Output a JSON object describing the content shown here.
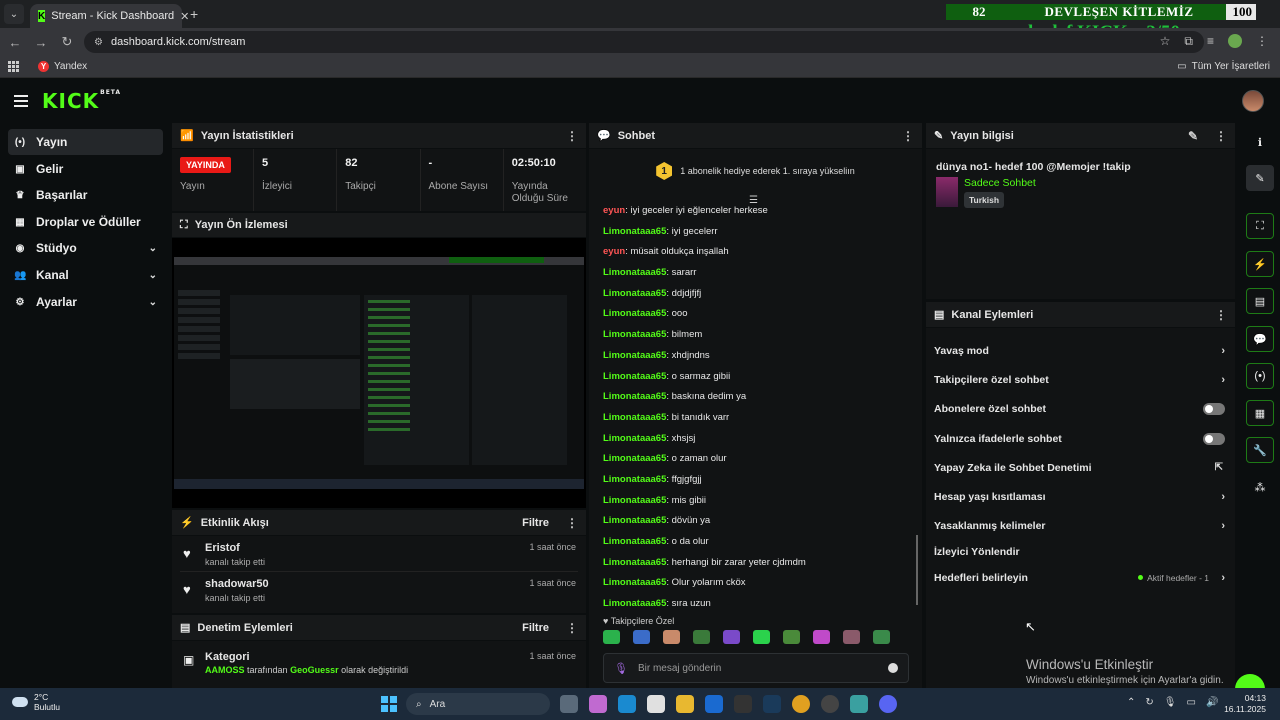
{
  "browser": {
    "tab_title": "Stream - Kick Dashboard",
    "url": "dashboard.kick.com/stream",
    "bookmark_yandex": "Yandex",
    "bookmarks_all": "Tüm Yer İşaretleri"
  },
  "overlay": {
    "count_left": "82",
    "title": "DEVLEŞEN KİTLEMİZ",
    "count_right": "100",
    "goal_text": "hedef KICKs: 2/50"
  },
  "app": {
    "logo": "KICK",
    "beta": "BETA"
  },
  "sidebar": {
    "items": [
      {
        "label": "Yayın"
      },
      {
        "label": "Gelir"
      },
      {
        "label": "Başarılar"
      },
      {
        "label": "Droplar ve Ödüller"
      },
      {
        "label": "Stüdyo"
      },
      {
        "label": "Kanal"
      },
      {
        "label": "Ayarlar"
      }
    ]
  },
  "stats": {
    "title": "Yayın İstatistikleri",
    "live_badge": "YAYINDA",
    "live_label": "Yayın",
    "viewers_value": "5",
    "viewers_label": "İzleyici",
    "followers_value": "82",
    "followers_label": "Takipçi",
    "subs_value": "-",
    "subs_label": "Abone Sayısı",
    "uptime_value": "02:50:10",
    "uptime_label": "Yayında Olduğu Süre"
  },
  "preview": {
    "title": "Yayın Ön İzlemesi"
  },
  "activity": {
    "title": "Etkinlik Akışı",
    "filter": "Filtre",
    "items": [
      {
        "name": "Eristof",
        "sub": "kanalı takip etti",
        "time": "1 saat önce"
      },
      {
        "name": "shadowar50",
        "sub": "kanalı takip etti",
        "time": "1 saat önce"
      }
    ]
  },
  "moderation": {
    "title": "Denetim Eylemleri",
    "filter": "Filtre",
    "item_title": "Kategori",
    "item_user": "AAMOSS",
    "item_mid": " tarafından ",
    "item_game": "GeoGuessr",
    "item_end": " olarak değiştirildi",
    "time": "1 saat önce"
  },
  "chat": {
    "title": "Sohbet",
    "banner": "1 abonelik hediye ederek 1. sıraya yükseliın",
    "medal": "1",
    "messages": [
      {
        "user": "eyun",
        "text": ": iyi geceler iyi eğlenceler herkese"
      },
      {
        "user": "Limonataaa65",
        "text": ": iyi gecelerr"
      },
      {
        "user": "eyun",
        "text": ": müsait oldukça inşallah"
      },
      {
        "user": "Limonataaa65",
        "text": ": sararr"
      },
      {
        "user": "Limonataaa65",
        "text": ": ddjdjfjfj"
      },
      {
        "user": "Limonataaa65",
        "text": ": ooo"
      },
      {
        "user": "Limonataaa65",
        "text": ": bilmem"
      },
      {
        "user": "Limonataaa65",
        "text": ": xhdjndns"
      },
      {
        "user": "Limonataaa65",
        "text": ": o sarmaz gibii"
      },
      {
        "user": "Limonataaa65",
        "text": ": baskına dedim ya"
      },
      {
        "user": "Limonataaa65",
        "text": ": bi tanıdık varr"
      },
      {
        "user": "Limonataaa65",
        "text": ": xhsjsj"
      },
      {
        "user": "Limonataaa65",
        "text": ": o zaman olur"
      },
      {
        "user": "Limonataaa65",
        "text": ": ffgjgfgjj"
      },
      {
        "user": "Limonataaa65",
        "text": ": mis gibii"
      },
      {
        "user": "Limonataaa65",
        "text": ": dövün ya"
      },
      {
        "user": "Limonataaa65",
        "text": ": o da olur"
      },
      {
        "user": "Limonataaa65",
        "text": ": herhangi bir zarar yeter cjdmdm"
      },
      {
        "user": "Limonataaa65",
        "text": ": Olur yolarım cköx"
      },
      {
        "user": "Limonataaa65",
        "text": ": sıra uzun"
      }
    ],
    "emotes_label": "Takipçilere Özel",
    "input_placeholder": "Bir mesaj gönderin"
  },
  "stream_info": {
    "title": "Yayın bilgisi",
    "stream_title": "dünya no1- hedef 100 @Memojer !takip",
    "category": "Sadece Sohbet",
    "tag": "Turkish"
  },
  "channel_actions": {
    "title": "Kanal Eylemleri",
    "items": [
      {
        "label": "Yavaş mod"
      },
      {
        "label": "Takipçilere özel sohbet"
      },
      {
        "label": "Abonelere özel sohbet"
      },
      {
        "label": "Yalnızca ifadelerle sohbet"
      },
      {
        "label": "Yapay Zeka ile Sohbet Denetimi"
      },
      {
        "label": "Hesap yaşı kısıtlaması"
      },
      {
        "label": "Yasaklanmış kelimeler"
      },
      {
        "label": "İzleyici Yönlendir"
      },
      {
        "label": "Hedefleri belirleyin"
      }
    ],
    "goals_status": "Aktif hedefler - 1"
  },
  "windows_activation": {
    "line1": "Windows'u Etkinleştir",
    "line2": "Windows'u etkinleştirmek için Ayarlar'a gidin."
  },
  "taskbar": {
    "temp": "2°C",
    "weather": "Bulutlu",
    "search": "Ara",
    "time": "04:13",
    "date": "16.11.2025"
  },
  "colors": {
    "kick_green": "#53fc18",
    "live_red": "#e91916"
  }
}
